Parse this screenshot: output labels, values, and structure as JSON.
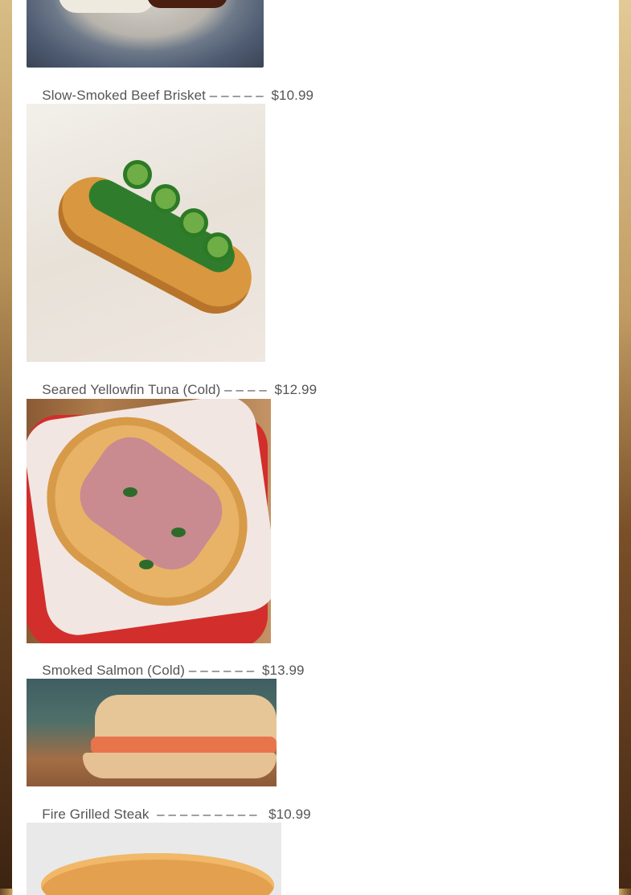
{
  "menu": {
    "items": [
      {
        "name": "Slow-Smoked Beef Brisket",
        "dashes": " – – – – – ",
        "price": "$10.99",
        "image_alt": "brisket-plate-photo"
      },
      {
        "name": "Seared Yellowfin Tuna (Cold)",
        "dashes": " – – – – ",
        "price": "$12.99",
        "image_alt": "jalapeno-sandwich-photo"
      },
      {
        "name": "Smoked Salmon (Cold)",
        "dashes": " – – – – – – ",
        "price": "$13.99",
        "image_alt": "tuna-sandwich-photo"
      },
      {
        "name": "Fire Grilled Steak",
        "dashes": "  – – – – – – – – –  ",
        "price": "$10.99",
        "image_alt": "salmon-sandwich-photo"
      }
    ],
    "last_image_alt": "baguette-photo"
  },
  "colors": {
    "label_text": "#555555",
    "content_bg": "#ffffff",
    "side_wood": "#7a4f28"
  }
}
